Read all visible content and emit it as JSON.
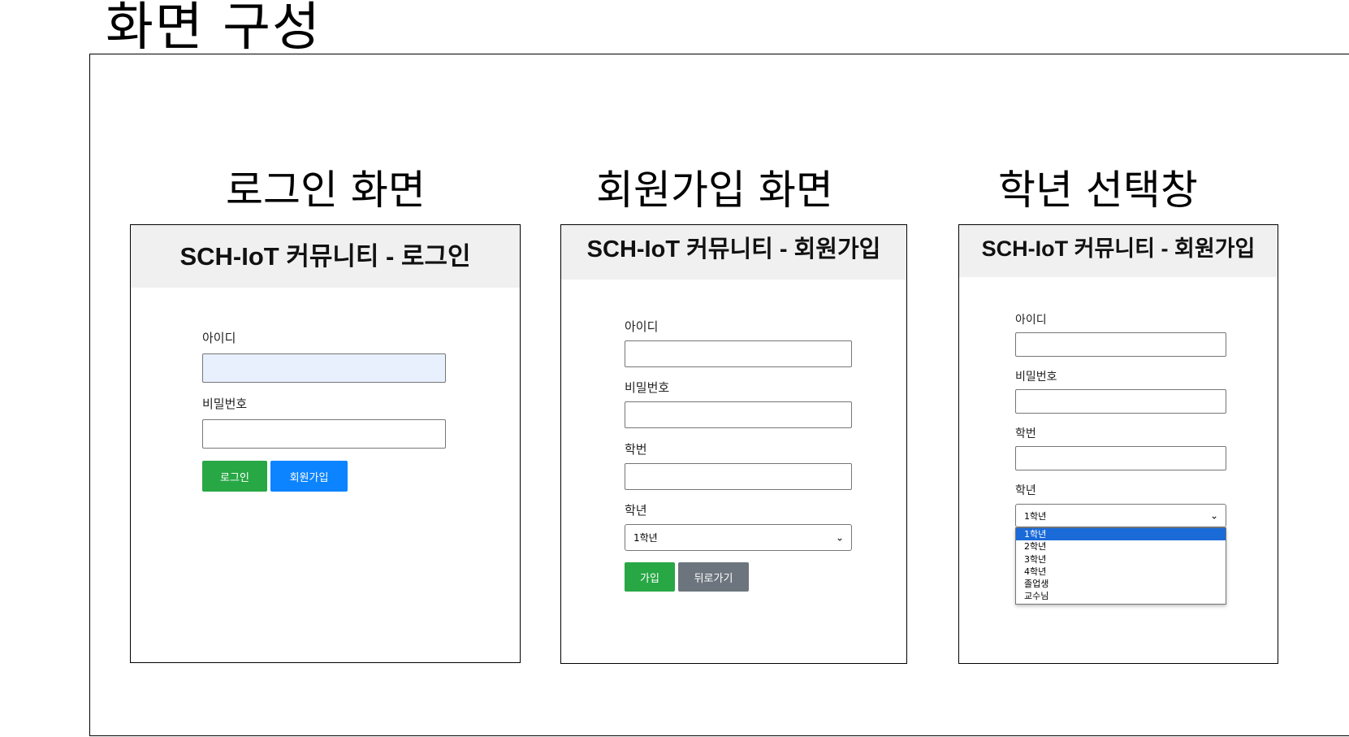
{
  "slide_title": "화면 구성",
  "captions": {
    "login": "로그인 화면",
    "signup": "회원가입 화면",
    "grade": "학년 선택창"
  },
  "login_panel": {
    "header": "SCH-IoT 커뮤니티 - 로그인",
    "id_label": "아이디",
    "id_value": "",
    "pw_label": "비밀번호",
    "pw_value": "",
    "login_button": "로그인",
    "signup_button": "회원가입"
  },
  "signup_panel": {
    "header": "SCH-IoT 커뮤니티 - 회원가입",
    "id_label": "아이디",
    "pw_label": "비밀번호",
    "student_no_label": "학번",
    "grade_label": "학년",
    "grade_selected": "1학년",
    "submit_button": "가입",
    "back_button": "뒤로가기"
  },
  "grade_panel": {
    "header": "SCH-IoT 커뮤니티 - 회원가입",
    "id_label": "아이디",
    "pw_label": "비밀번호",
    "student_no_label": "학번",
    "grade_label": "학년",
    "grade_selected": "1학년",
    "options": [
      "1학년",
      "2학년",
      "3학년",
      "4학년",
      "졸업생",
      "교수님"
    ]
  },
  "colors": {
    "green": "#28a745",
    "blue": "#0d84ff",
    "gray": "#6c757d",
    "option_highlight": "#1a6ad8",
    "header_bg": "#f0f0f0",
    "focused_input": "#e8f0fe"
  },
  "icons": {
    "select_chevron": "chevron-down-icon"
  }
}
